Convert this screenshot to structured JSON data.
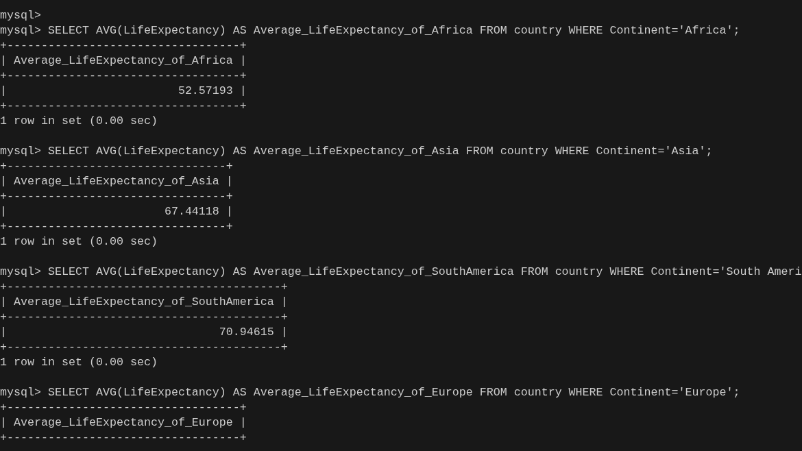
{
  "terminal": {
    "blocks": [
      {
        "lines": [
          "mysql>",
          "mysql> SELECT AVG(LifeExpectancy) AS Average_LifeExpectancy_of_Africa FROM country WHERE Continent='Africa';",
          "+----------------------------------+",
          "| Average_LifeExpectancy_of_Africa |",
          "+----------------------------------+",
          "|                         52.57193 |",
          "+----------------------------------+",
          "1 row in set (0.00 sec)"
        ]
      },
      {
        "lines": [
          "mysql> SELECT AVG(LifeExpectancy) AS Average_LifeExpectancy_of_Asia FROM country WHERE Continent='Asia';",
          "+--------------------------------+",
          "| Average_LifeExpectancy_of_Asia |",
          "+--------------------------------+",
          "|                       67.44118 |",
          "+--------------------------------+",
          "1 row in set (0.00 sec)"
        ]
      },
      {
        "lines": [
          "mysql> SELECT AVG(LifeExpectancy) AS Average_LifeExpectancy_of_SouthAmerica FROM country WHERE Continent='South Ameri",
          "+----------------------------------------+",
          "| Average_LifeExpectancy_of_SouthAmerica |",
          "+----------------------------------------+",
          "|                               70.94615 |",
          "+----------------------------------------+",
          "1 row in set (0.00 sec)"
        ]
      },
      {
        "lines": [
          "mysql> SELECT AVG(LifeExpectancy) AS Average_LifeExpectancy_of_Europe FROM country WHERE Continent='Europe';",
          "+----------------------------------+",
          "| Average_LifeExpectancy_of_Europe |",
          "+----------------------------------+"
        ]
      }
    ]
  }
}
